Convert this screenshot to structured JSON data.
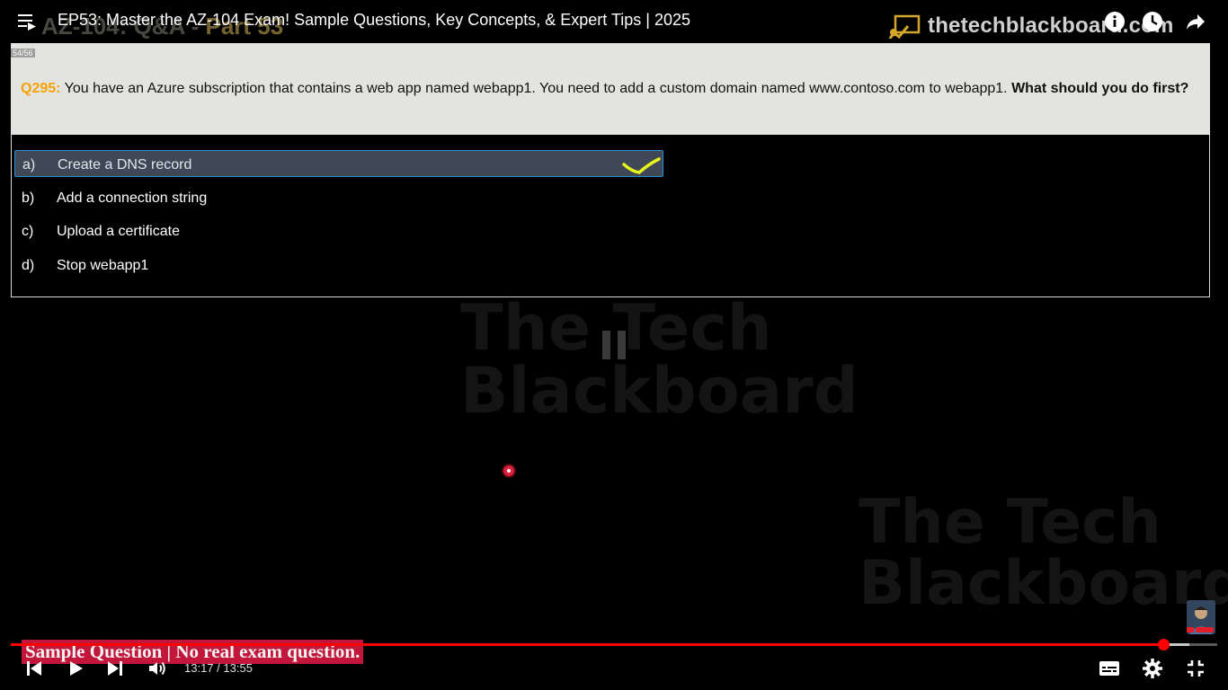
{
  "player": {
    "video_title": "EP53: Master the AZ-104 Exam! Sample Questions, Key Concepts, & Expert Tips | 2025",
    "time_current": "13:17",
    "time_separator": " / ",
    "time_total": "13:55",
    "progress": 0.955,
    "buffered": 0.977,
    "accent_color": "#ff0000"
  },
  "overlay": {
    "slide_watermark_prefix": "AZ-104: Q&A - ",
    "slide_watermark_part": "Part 53",
    "brand": "thetechblackboard.com"
  },
  "slide": {
    "counter": "54/56",
    "question_number": "Q295:",
    "question_text": " You have an Azure subscription that contains a web app named webapp1. You need to add a custom domain named www.contoso.com to webapp1. ",
    "question_prompt": "What should you do first?",
    "options": [
      {
        "letter": "a)",
        "text": "Create a DNS record",
        "selected": true
      },
      {
        "letter": "b)",
        "text": "Add a connection string",
        "selected": false
      },
      {
        "letter": "c)",
        "text": "Upload a certificate",
        "selected": false
      },
      {
        "letter": "d)",
        "text": "Stop webapp1",
        "selected": false
      }
    ]
  },
  "ghost_brand": {
    "line1": "The Tech",
    "line2": "Blackboard"
  },
  "subtitle": "Sample Question | No real exam question."
}
